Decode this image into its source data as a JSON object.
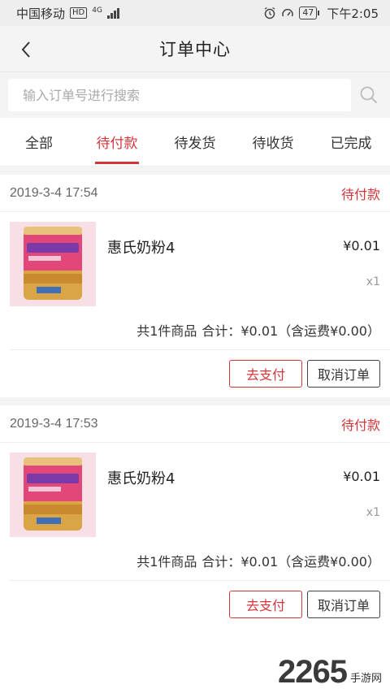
{
  "status_bar": {
    "carrier": "中国移动",
    "hd": "HD",
    "network": "4G",
    "battery": "47",
    "time": "下午2:05"
  },
  "nav": {
    "title": "订单中心"
  },
  "search": {
    "placeholder": "输入订单号进行搜索"
  },
  "tabs": [
    {
      "label": "全部",
      "active": false
    },
    {
      "label": "待付款",
      "active": true
    },
    {
      "label": "待发货",
      "active": false
    },
    {
      "label": "待收货",
      "active": false
    },
    {
      "label": "已完成",
      "active": false
    }
  ],
  "orders": [
    {
      "time": "2019-3-4 17:54",
      "status": "待付款",
      "item": {
        "name": "惠氏奶粉4",
        "price": "¥0.01",
        "qty": "x1"
      },
      "summary": {
        "count_text": "共1件商品",
        "total_text": "合计：¥0.01（含运费¥0.00）"
      },
      "pay_label": "去支付",
      "cancel_label": "取消订单"
    },
    {
      "time": "2019-3-4 17:53",
      "status": "待付款",
      "item": {
        "name": "惠氏奶粉4",
        "price": "¥0.01",
        "qty": "x1"
      },
      "summary": {
        "count_text": "共1件商品",
        "total_text": "合计：¥0.01（含运费¥0.00）"
      },
      "pay_label": "去支付",
      "cancel_label": "取消订单"
    }
  ],
  "watermark": {
    "number": "2265",
    "text": "手游网"
  },
  "colors": {
    "accent": "#d6363a",
    "background": "#f4f4f4"
  },
  "icons": {
    "back": "chevron-left-icon",
    "search": "search-icon",
    "alarm": "alarm-icon",
    "speed": "speed-icon",
    "product": "milk-powder-can-image"
  }
}
